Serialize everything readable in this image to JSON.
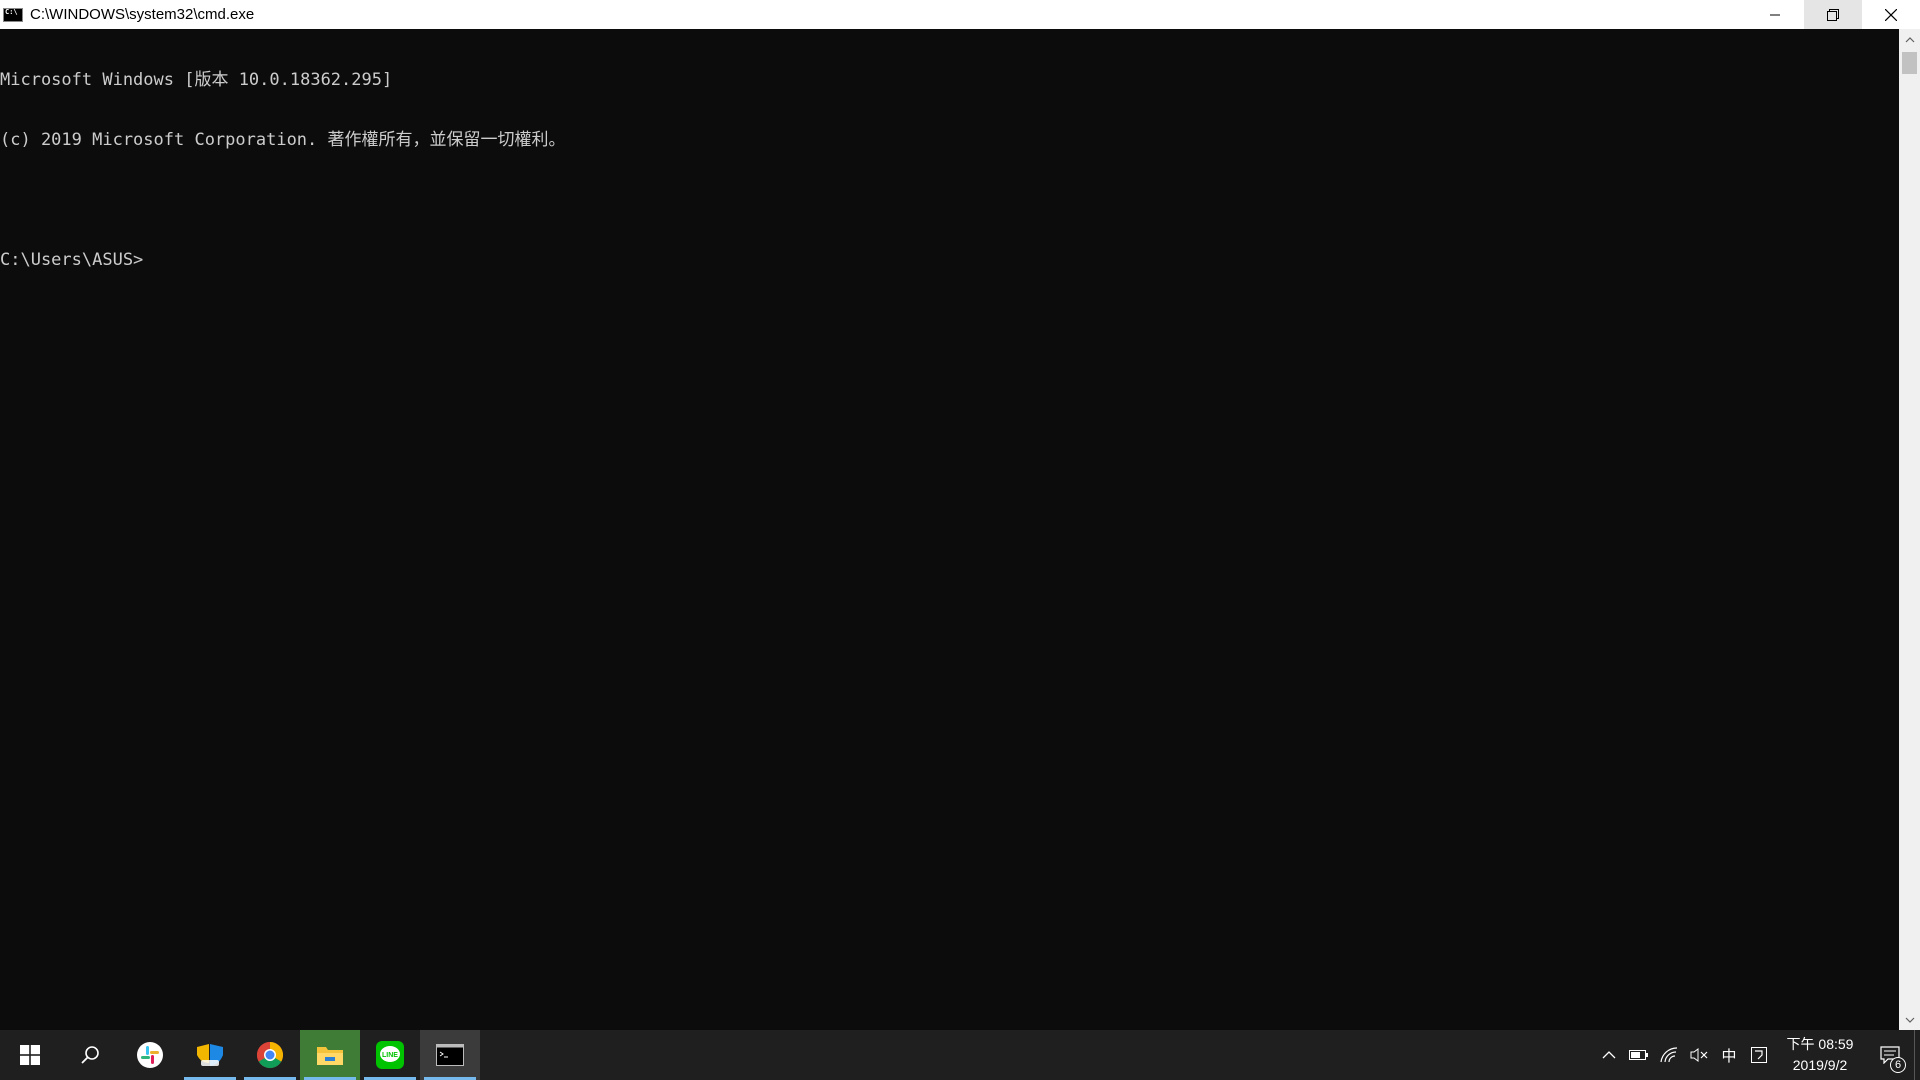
{
  "window": {
    "title": "C:\\WINDOWS\\system32\\cmd.exe"
  },
  "console": {
    "lines": [
      "Microsoft Windows [版本 10.0.18362.295]",
      "(c) 2019 Microsoft Corporation. 著作權所有，並保留一切權利。",
      "",
      "C:\\Users\\ASUS>"
    ]
  },
  "taskbar": {
    "apps": [
      {
        "name": "start-icon"
      },
      {
        "name": "search-icon"
      },
      {
        "name": "slack-icon"
      },
      {
        "name": "security-icon"
      },
      {
        "name": "chrome-icon"
      },
      {
        "name": "file-explorer-icon"
      },
      {
        "name": "line-icon"
      },
      {
        "name": "cmd-icon"
      }
    ],
    "tray": {
      "ime_label": "中",
      "time": "下午 08:59",
      "date": "2019/9/2",
      "notification_count": "6"
    }
  },
  "colors": {
    "console_bg": "#0c0c0c",
    "console_fg": "#cccccc",
    "taskbar_bg": "#1f1f1f",
    "accent_underline": "#76b9ed"
  }
}
